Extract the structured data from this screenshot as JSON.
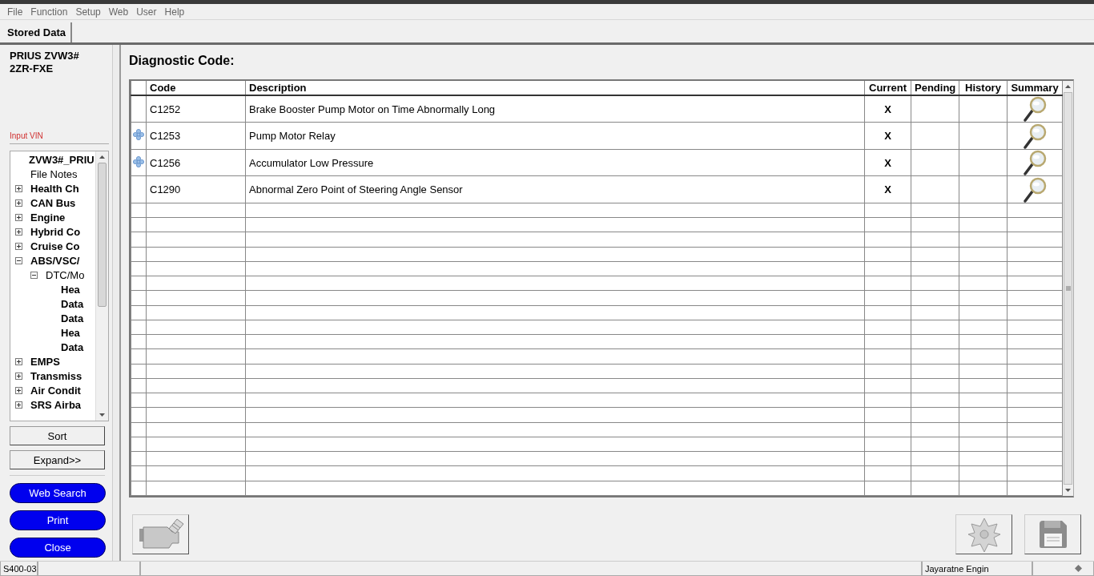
{
  "menu": [
    "File",
    "Function",
    "Setup",
    "Web",
    "User",
    "Help"
  ],
  "tabs": [
    {
      "label": "Stored Data",
      "selected": true
    }
  ],
  "vehicle": {
    "model": "PRIUS ZVW3#",
    "engine": "2ZR-FXE",
    "vin_label": "Input VIN"
  },
  "tree": [
    {
      "label": "ZVW3#_PRIU",
      "kind": "root",
      "bold": true,
      "children": [
        {
          "label": "File Notes",
          "kind": "leaf",
          "bold": false
        },
        {
          "label": "Health Ch",
          "kind": "folder",
          "expanded": false,
          "bold": true
        },
        {
          "label": "CAN Bus",
          "kind": "folder",
          "expanded": false,
          "bold": true
        },
        {
          "label": "Engine",
          "kind": "folder",
          "expanded": false,
          "bold": true
        },
        {
          "label": "Hybrid Co",
          "kind": "folder",
          "expanded": false,
          "bold": true
        },
        {
          "label": "Cruise Co",
          "kind": "folder",
          "expanded": false,
          "bold": true
        },
        {
          "label": "ABS/VSC/",
          "kind": "folder",
          "expanded": true,
          "bold": true,
          "children": [
            {
              "label": "DTC/Mo",
              "kind": "folder",
              "expanded": true,
              "bold": false,
              "children": [
                {
                  "label": "Hea",
                  "kind": "leaf",
                  "bold": true
                },
                {
                  "label": "Data",
                  "kind": "leaf",
                  "bold": true
                },
                {
                  "label": "Data",
                  "kind": "leaf",
                  "bold": true
                },
                {
                  "label": "Hea",
                  "kind": "leaf",
                  "bold": true
                },
                {
                  "label": "Data",
                  "kind": "leaf",
                  "bold": true
                }
              ]
            }
          ]
        },
        {
          "label": "EMPS",
          "kind": "folder",
          "expanded": false,
          "bold": true
        },
        {
          "label": "Transmiss",
          "kind": "folder",
          "expanded": false,
          "bold": true
        },
        {
          "label": "Air Condit",
          "kind": "folder",
          "expanded": false,
          "bold": true
        },
        {
          "label": "SRS Airba",
          "kind": "folder",
          "expanded": false,
          "bold": true
        }
      ]
    }
  ],
  "side_buttons": [
    {
      "label": "Sort",
      "kind": "plain"
    },
    {
      "label": "Expand>>",
      "kind": "plain"
    },
    {
      "label": "Web Search",
      "kind": "pill"
    },
    {
      "label": "Print",
      "kind": "pill"
    },
    {
      "label": "Close",
      "kind": "pill"
    }
  ],
  "title": "Diagnostic Code:",
  "table": {
    "columns": [
      "Code",
      "Description",
      "Current",
      "Pending",
      "History",
      "Summary"
    ],
    "rows": [
      {
        "code": "C1252",
        "description": "Brake Booster Pump Motor on Time Abnormally Long",
        "current": "X",
        "flagged": false
      },
      {
        "code": "C1253",
        "description": "Pump Motor Relay",
        "current": "X",
        "flagged": true
      },
      {
        "code": "C1256",
        "description": "Accumulator Low Pressure",
        "current": "X",
        "flagged": true
      },
      {
        "code": "C1290",
        "description": "Abnormal Zero Point of Steering Angle Sensor",
        "current": "X",
        "flagged": false
      }
    ]
  },
  "status_bar": {
    "left": "S400-03",
    "user": "Jayaratne Engin"
  }
}
